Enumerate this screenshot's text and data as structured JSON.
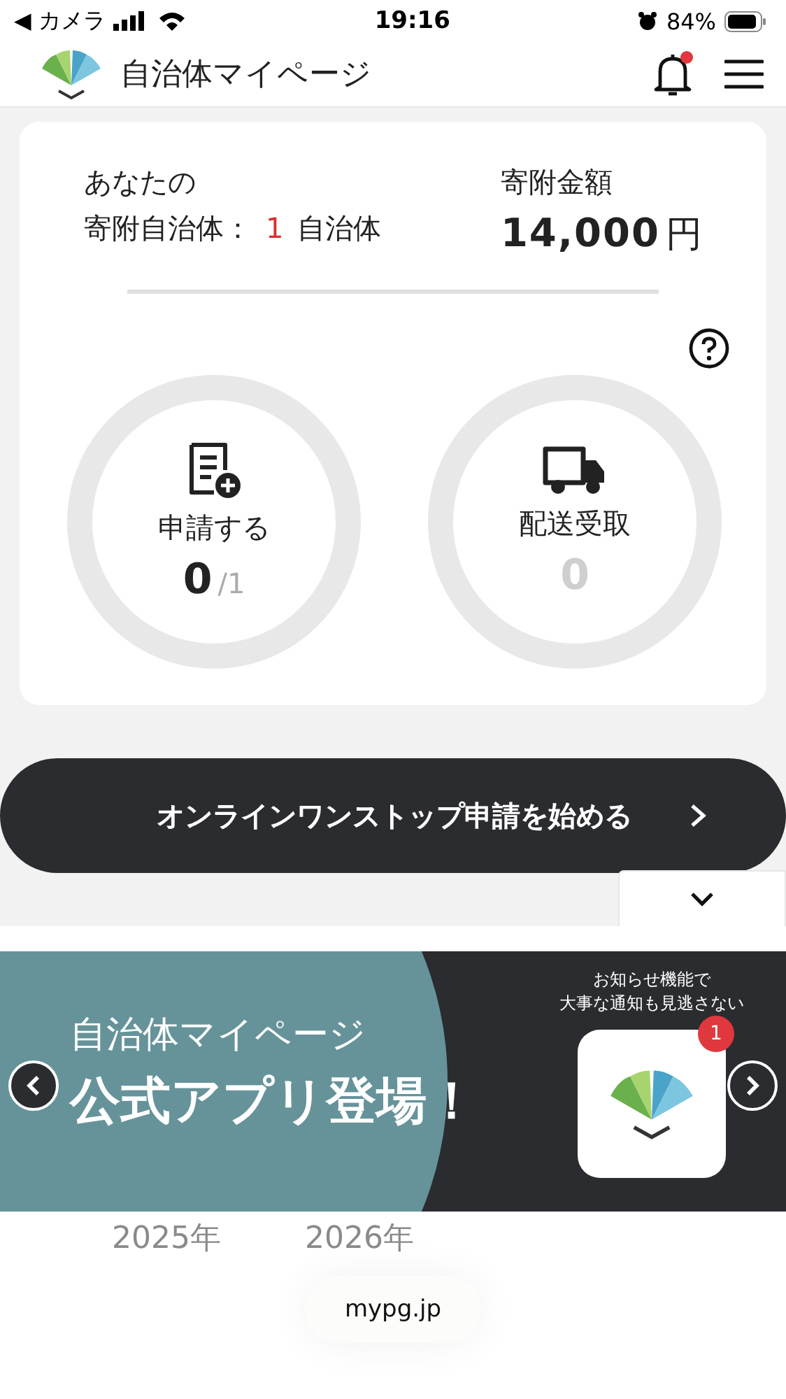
{
  "status_bar": {
    "back": "◀ カメラ",
    "time": "19:16",
    "battery": "84%"
  },
  "header": {
    "title": "自治体マイページ",
    "has_unread": true
  },
  "summary": {
    "heading": "あなたの",
    "municipalities_label": "寄附自治体：",
    "municipalities_count": "1",
    "municipalities_unit": "自治体",
    "amount_label": "寄附金額",
    "amount": "14,000",
    "amount_unit": "円"
  },
  "counters": [
    {
      "kind": "apply",
      "label": "申請する",
      "value": "0",
      "total": "/1",
      "active": true
    },
    {
      "kind": "delivery",
      "label": "配送受取",
      "value": "0",
      "active": false
    }
  ],
  "cta": {
    "label": "オンラインワンストップ申請を始める"
  },
  "banner": {
    "title": "自治体マイページ",
    "headline": "公式アプリ登場！",
    "note_lines": [
      "お知らせ機能で",
      "大事な通知も見逃さない"
    ],
    "badge": "1"
  },
  "years": [
    "2025年",
    "2026年"
  ],
  "footer": {
    "url": "mypg.jp"
  }
}
